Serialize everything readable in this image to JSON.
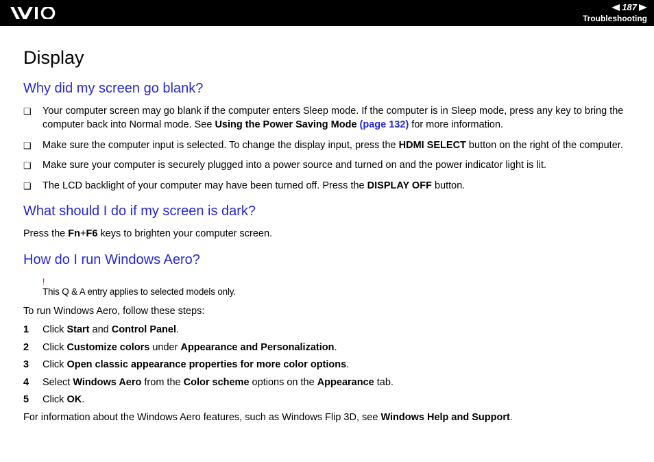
{
  "header": {
    "page_number": "187",
    "section": "Troubleshooting"
  },
  "title": "Display",
  "q1": {
    "heading": "Why did my screen go blank?",
    "items": [
      {
        "pre": "Your computer screen may go blank if the computer enters Sleep mode. If the computer is in Sleep mode, press any key to bring the computer back into Normal mode. See ",
        "b1": "Using the Power Saving Mode ",
        "link": "(page 132)",
        "post": " for more information."
      },
      {
        "pre": "Make sure the computer input is selected. To change the display input, press the ",
        "b1": "HDMI SELECT",
        "post": " button on the right of the computer."
      },
      {
        "pre": "Make sure your computer is securely plugged into a power source and turned on and the power indicator light is lit."
      },
      {
        "pre": "The LCD backlight of your computer may have been turned off. Press the ",
        "b1": "DISPLAY OFF",
        "post": " button."
      }
    ]
  },
  "q2": {
    "heading": "What should I do if my screen is dark?",
    "text_pre": "Press the ",
    "text_b1": "Fn",
    "text_mid": "+",
    "text_b2": "F6",
    "text_post": " keys to brighten your computer screen."
  },
  "q3": {
    "heading": "How do I run Windows Aero?",
    "note_excl": "!",
    "note": "This Q & A entry applies to selected models only.",
    "intro": "To run Windows Aero, follow these steps:",
    "steps": [
      {
        "t1": "Click ",
        "b1": "Start",
        "t2": " and ",
        "b2": "Control Panel",
        "t3": "."
      },
      {
        "t1": "Click ",
        "b1": "Customize colors",
        "t2": " under ",
        "b2": "Appearance and Personalization",
        "t3": "."
      },
      {
        "t1": "Click ",
        "b1": "Open classic appearance properties for more color options",
        "t2": "."
      },
      {
        "t1": "Select ",
        "b1": "Windows Aero",
        "t2": " from the ",
        "b2": "Color scheme",
        "t3": " options on the ",
        "b3": "Appearance",
        "t4": " tab."
      },
      {
        "t1": "Click ",
        "b1": "OK",
        "t2": "."
      }
    ],
    "outro_pre": "For information about the Windows Aero features, such as Windows Flip 3D, see ",
    "outro_b": "Windows Help and Support",
    "outro_post": "."
  }
}
